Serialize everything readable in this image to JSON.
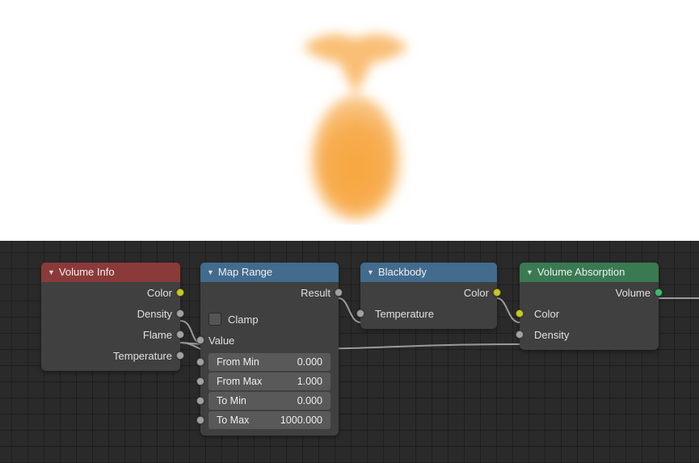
{
  "preview": {
    "description": "orange volumetric render"
  },
  "nodes": {
    "volume_info": {
      "title": "Volume Info",
      "outputs": [
        "Color",
        "Density",
        "Flame",
        "Temperature"
      ]
    },
    "map_range": {
      "title": "Map Range",
      "out_result": "Result",
      "clamp_label": "Clamp",
      "value_label": "Value",
      "fields": [
        {
          "label": "From Min",
          "value": "0.000"
        },
        {
          "label": "From Max",
          "value": "1.000"
        },
        {
          "label": "To Min",
          "value": "0.000"
        },
        {
          "label": "To Max",
          "value": "1000.000"
        }
      ]
    },
    "blackbody": {
      "title": "Blackbody",
      "out_color": "Color",
      "in_temperature": "Temperature"
    },
    "volume_absorption": {
      "title": "Volume Absorption",
      "out_volume": "Volume",
      "in_color": "Color",
      "in_density": "Density"
    }
  }
}
